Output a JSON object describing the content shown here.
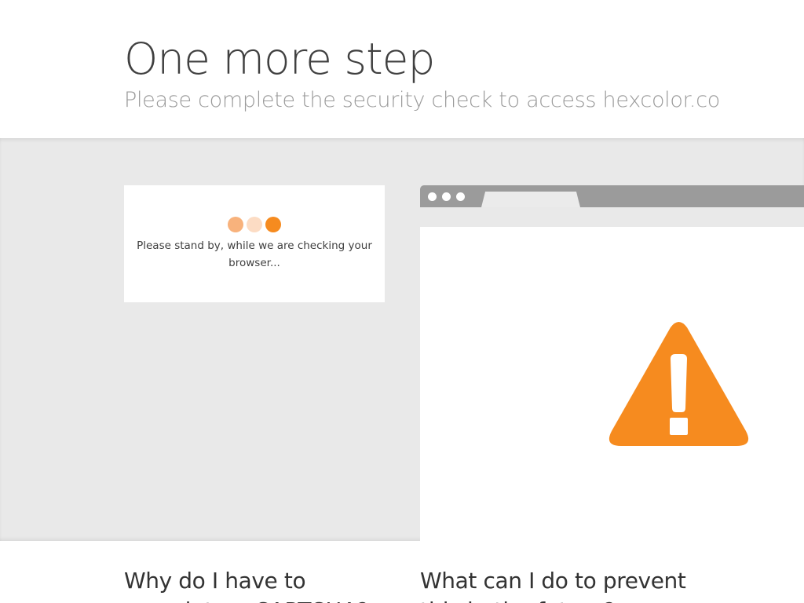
{
  "header": {
    "title": "One more step",
    "subtitle": "Please complete the security check to access hexcolor.co"
  },
  "check": {
    "message": "Please stand by, while we are checking your browser...",
    "dot_colors": [
      "#f8b27c",
      "#fcdcc4",
      "#f68b1f"
    ]
  },
  "illustration": {
    "warning_color": "#f68b1f",
    "icon": "warning-triangle-icon"
  },
  "faq": {
    "q1_line1": "Why do I have to",
    "q1_line2": "complete a CAPTCHA?",
    "q2_line1": "What can I do to prevent",
    "q2_line2": "this in the future?"
  },
  "colors": {
    "band_background": "#e9e9e9",
    "browser_bar": "#9b9b9b",
    "accent": "#f68b1f"
  }
}
